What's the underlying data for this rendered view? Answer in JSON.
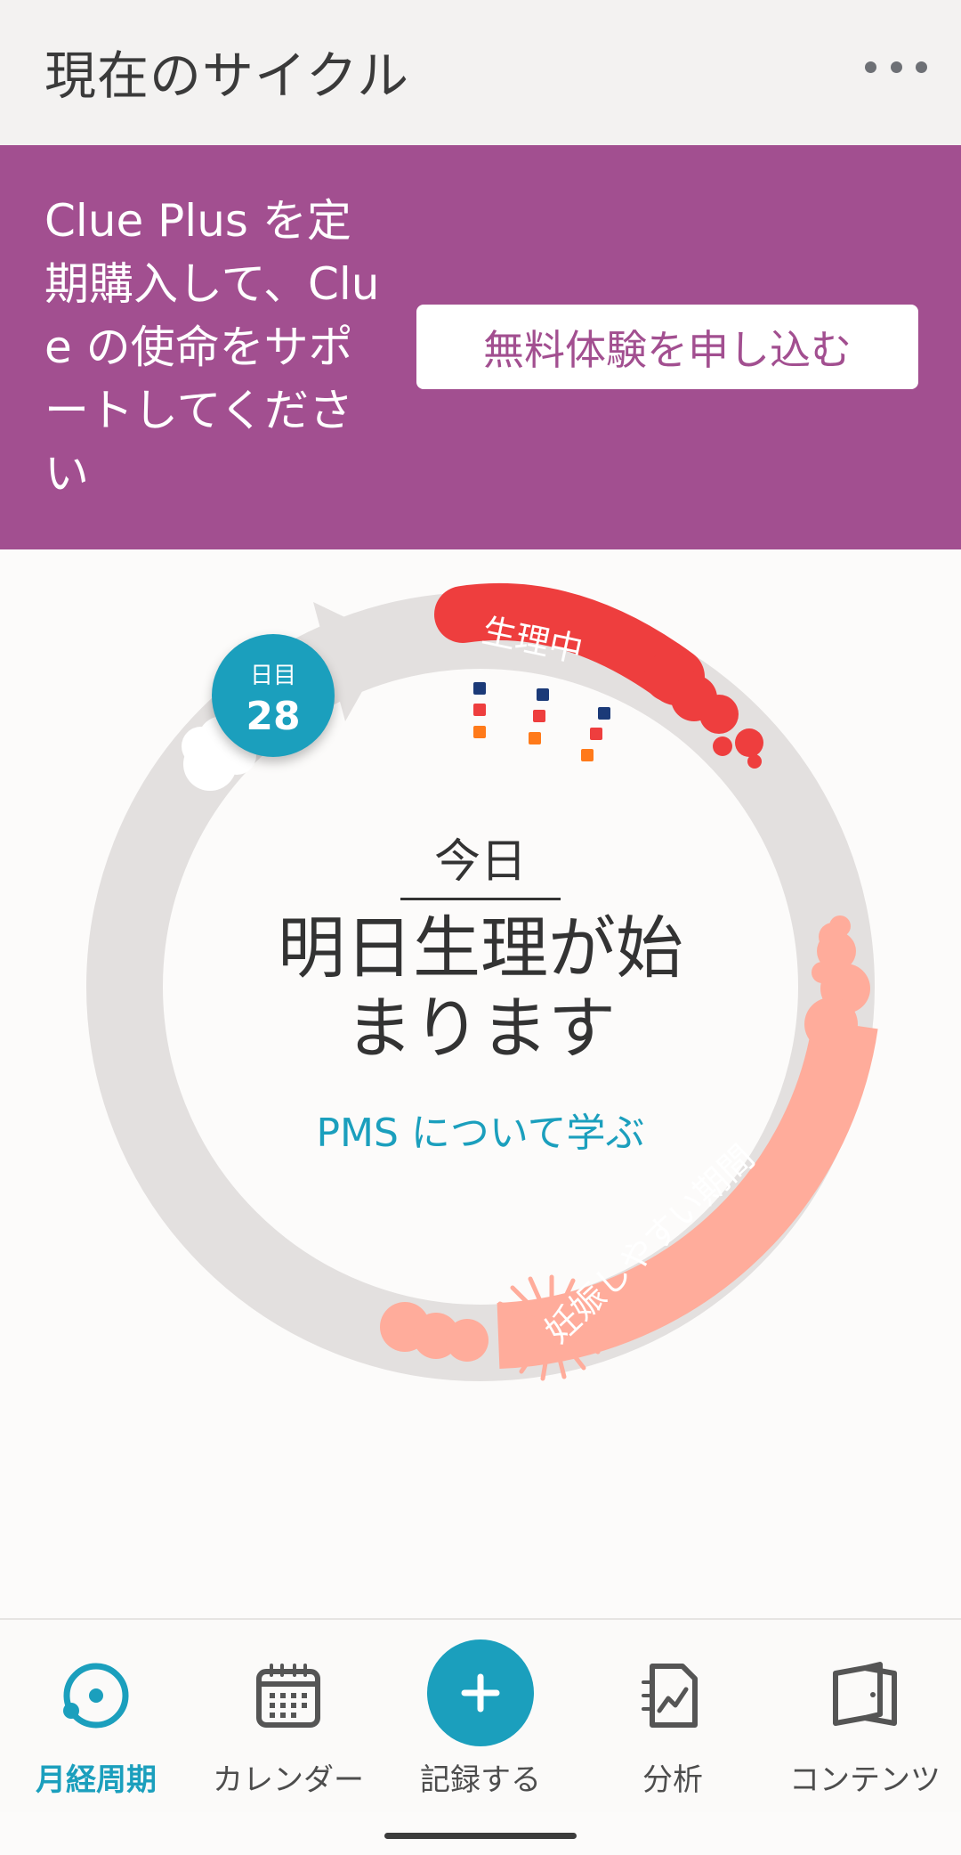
{
  "header": {
    "title": "現在のサイクル",
    "more_icon": "more-horizontal-icon"
  },
  "promo": {
    "text": "Clue Plus を定期購入して、Clue の使命をサポートしてください",
    "button_label": "無料体験を申し込む",
    "background": "#a24f90"
  },
  "cycle": {
    "day_label": "日目",
    "day_number": "28",
    "period_label": "生理中",
    "fertile_label": "妊娠しやすい期間",
    "today_label": "今日",
    "message": "明日生理が始まります",
    "pms_link": "PMS について学ぶ",
    "colors": {
      "ring": "#e3e0df",
      "period": "#ee3e3e",
      "fertile": "#ffac9b",
      "accent": "#1b9fbd"
    }
  },
  "nav": {
    "items": [
      {
        "label": "月経周期",
        "icon": "cycle-icon",
        "active": true
      },
      {
        "label": "カレンダー",
        "icon": "calendar-icon",
        "active": false
      },
      {
        "label": "記録する",
        "icon": "plus-icon",
        "active": false
      },
      {
        "label": "分析",
        "icon": "analysis-icon",
        "active": false
      },
      {
        "label": "コンテンツ",
        "icon": "book-icon",
        "active": false
      }
    ]
  }
}
